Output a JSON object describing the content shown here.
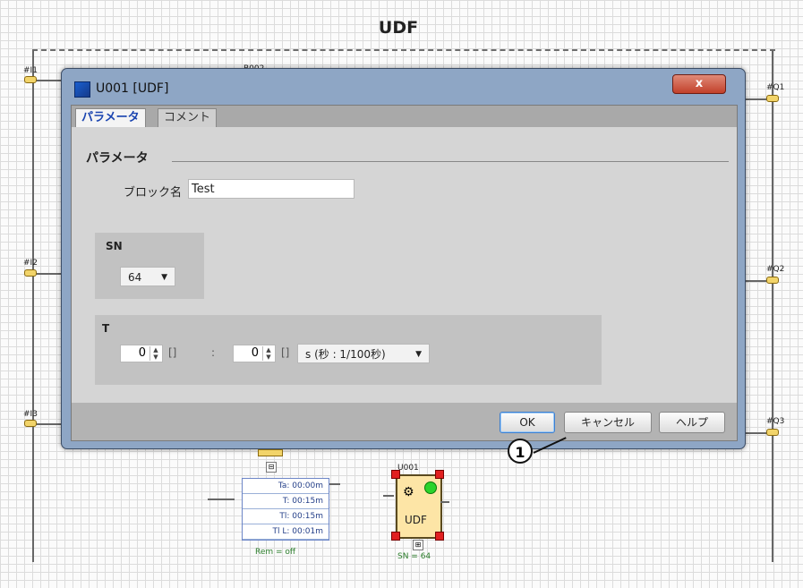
{
  "canvas": {
    "title": "UDF",
    "ports_left": [
      "#I1",
      "#I2",
      "#I3"
    ],
    "ports_right": [
      "#Q1",
      "#Q2",
      "#Q3"
    ],
    "hidden_block_label": "B002"
  },
  "dialog": {
    "title": "U001 [UDF]",
    "close_label": "x",
    "tabs": [
      {
        "label": "パラメータ",
        "active": true
      },
      {
        "label": "コメント",
        "active": false
      }
    ],
    "section_title": "パラメータ",
    "block_name_label": "ブロック名",
    "block_name_value": "Test",
    "sn_group_label": "SN",
    "sn_value": "64",
    "t_group_label": "T",
    "t_value_1": "0",
    "t_value_1_unit": "[]",
    "separator": ":",
    "t_value_2": "0",
    "t_value_2_unit": "[]",
    "timebase_value": "s (秒 : 1/100秒)",
    "buttons": {
      "ok": "OK",
      "cancel": "キャンセル",
      "help": "ヘルプ"
    }
  },
  "callout": {
    "number": "1"
  },
  "timer_block": {
    "rows": [
      "Ta: 00:00m",
      "T: 00:15m",
      "Tl: 00:15m",
      "Tl L: 00:01m"
    ],
    "rem": "Rem = off"
  },
  "udf_block": {
    "label": "U001",
    "text": "UDF",
    "sn": "SN = 64"
  },
  "colors": {
    "dialog_frame": "#8ea6c5",
    "active_tab_text": "#1a44b0",
    "close_button": "#c2402a",
    "udf_fill": "#fde5a6"
  }
}
